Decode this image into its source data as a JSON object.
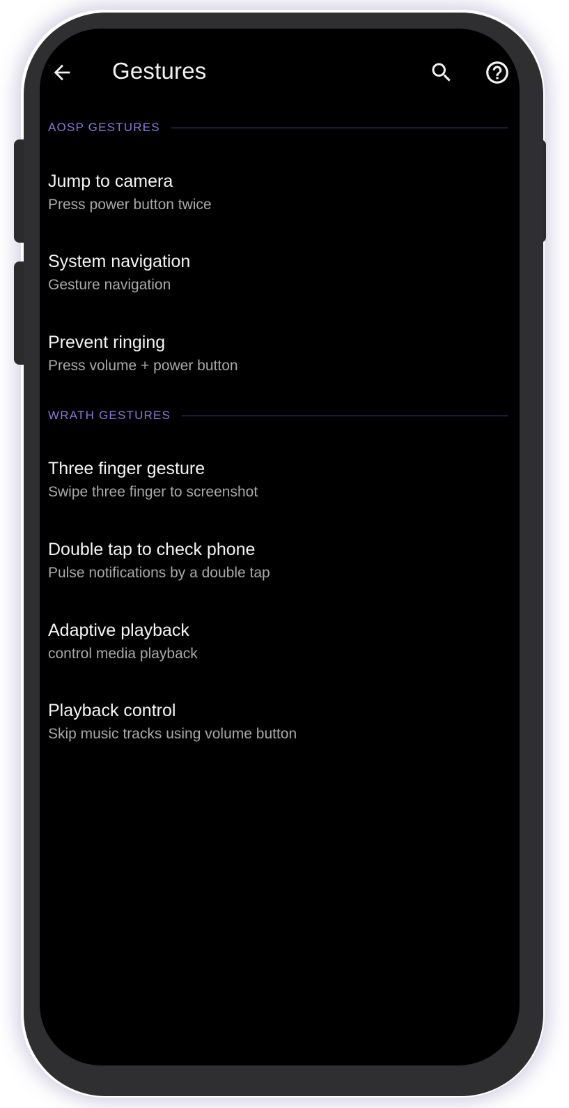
{
  "app_bar": {
    "title": "Gestures",
    "back_icon": "arrow-left",
    "search_icon": "magnifier",
    "help_icon": "question-circle"
  },
  "colors": {
    "background": "#000000",
    "accent": "#8a79d6",
    "title_text": "#f4f4f4",
    "summary_text": "#a9a9a9",
    "frame": "#2f2f31"
  },
  "sections": {
    "aosp": {
      "label": "AOSP GESTURES",
      "items": [
        {
          "title": "Jump to camera",
          "summary": "Press power button twice"
        },
        {
          "title": "System navigation",
          "summary": "Gesture navigation"
        },
        {
          "title": "Prevent ringing",
          "summary": "Press volume + power button"
        }
      ]
    },
    "wrath": {
      "label": "WRATH GESTURES",
      "items": [
        {
          "title": "Three finger gesture",
          "summary": "Swipe three finger to screenshot"
        },
        {
          "title": "Double tap to check phone",
          "summary": "Pulse notifications by a double tap"
        },
        {
          "title": "Adaptive playback",
          "summary": "control media playback"
        },
        {
          "title": "Playback control",
          "summary": "Skip music tracks using volume button"
        }
      ]
    }
  }
}
